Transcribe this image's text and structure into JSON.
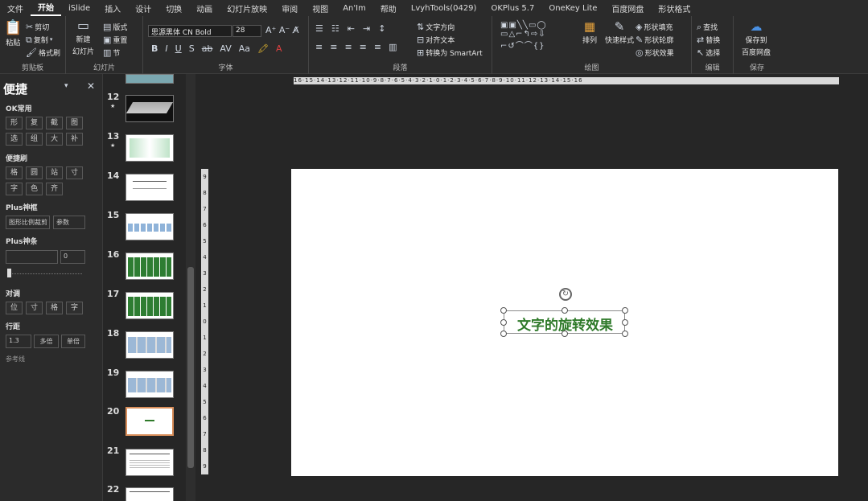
{
  "tabs": [
    "文件",
    "开始",
    "iSlide",
    "插入",
    "设计",
    "切换",
    "动画",
    "幻灯片放映",
    "审阅",
    "视图",
    "An'Im",
    "帮助",
    "LvyhTools(0429)",
    "OKPlus 5.7",
    "OneKey Lite",
    "百度网盘",
    "形状格式"
  ],
  "clipboard": {
    "paste": "粘贴",
    "cut": "剪切",
    "copy": "复制",
    "format_painter": "格式刷",
    "label": "剪贴板"
  },
  "slides_group": {
    "new": "新建",
    "new2": "幻灯片",
    "layout": "版式",
    "reset": "重置",
    "section": "节",
    "label": "幻灯片"
  },
  "font": {
    "name": "思源黑体 CN Bold",
    "size": "28",
    "label": "字体",
    "aa": "Aa"
  },
  "paragraph": {
    "text_dir": "文字方向",
    "align_text": "对齐文本",
    "smartart": "转换为 SmartArt",
    "label": "段落"
  },
  "drawing": {
    "arrange": "排列",
    "quick_styles": "快速样式",
    "fill": "形状填充",
    "outline": "形状轮廓",
    "effects": "形状效果",
    "label": "绘图"
  },
  "editing": {
    "find": "查找",
    "replace": "替换",
    "select": "选择",
    "label": "编辑"
  },
  "save": {
    "btn1": "保存到",
    "btn2": "百度网盘",
    "label": "保存"
  },
  "pane": {
    "title": "便捷",
    "sec1": "OK常用",
    "row1": [
      "形",
      "复",
      "截",
      "图"
    ],
    "row2": [
      "选",
      "组",
      "大",
      "补"
    ],
    "sec2": "便捷刷",
    "row3": [
      "格",
      "圆",
      "站",
      "寸"
    ],
    "row4": [
      "字",
      "色",
      "齐"
    ],
    "sec3": "Plus神框",
    "crop_btn": "图形比例裁剪",
    "param": "参数",
    "sec4": "Plus神条",
    "slider_val": "0",
    "sec5": "对调",
    "row5": [
      "位",
      "寸",
      "格",
      "字"
    ],
    "sec6": "行距",
    "spacing_val": "1.3",
    "multi": "多倍",
    "single": "单倍",
    "ref": "参考线"
  },
  "thumbnails": [
    {
      "num": "12",
      "star": "★"
    },
    {
      "num": "13",
      "star": "★"
    },
    {
      "num": "14",
      "star": ""
    },
    {
      "num": "15",
      "star": ""
    },
    {
      "num": "16",
      "star": ""
    },
    {
      "num": "17",
      "star": ""
    },
    {
      "num": "18",
      "star": ""
    },
    {
      "num": "19",
      "star": ""
    },
    {
      "num": "20",
      "star": ""
    },
    {
      "num": "21",
      "star": ""
    },
    {
      "num": "22",
      "star": ""
    }
  ],
  "ruler": {
    "h": "16·15·14·13·12·11·10·9·8·7·6·5·4·3·2·1·0·1·2·3·4·5·6·7·8·9·10·11·12·13·14·15·16",
    "v": "9 8 7 6 5 4 3 2 1 0 1 2 3 4 5 6 7 8 9"
  },
  "slide": {
    "text": "文字的旋转效果",
    "text_color": "#2f7a2a"
  }
}
